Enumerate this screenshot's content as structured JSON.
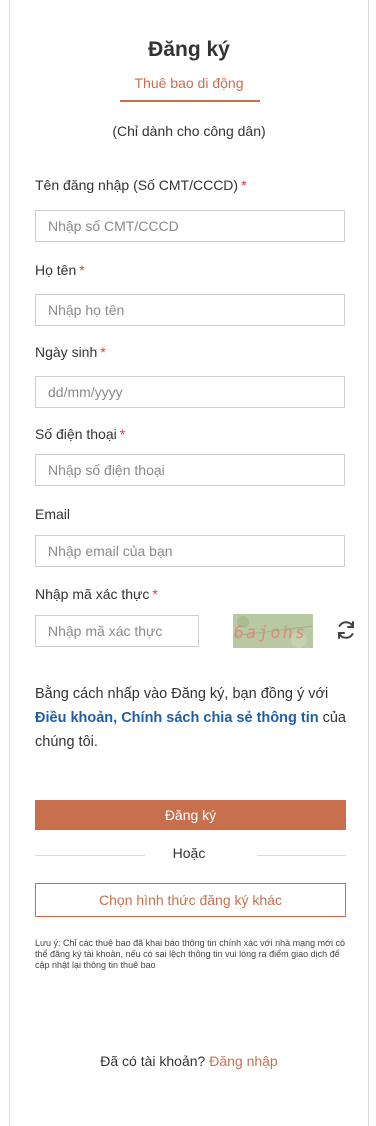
{
  "header": {
    "title": "Đăng ký",
    "subtitle": "Thuê bao di động",
    "citizen_note": "(Chỉ dành cho công dân)"
  },
  "form": {
    "username": {
      "label": "Tên đăng nhập (Số CMT/CCCD)",
      "required_mark": "*",
      "placeholder": "Nhập số CMT/CCCD"
    },
    "fullname": {
      "label": "Họ tên",
      "required_mark": "*",
      "placeholder": "Nhập họ tên"
    },
    "birthday": {
      "label": "Ngày sinh",
      "required_mark": "*",
      "placeholder": "dd/mm/yyyy"
    },
    "phone": {
      "label": "Số điện thoại",
      "required_mark": "*",
      "placeholder": "Nhập số điện thoại"
    },
    "email": {
      "label": "Email",
      "placeholder": "Nhập email của bạn"
    },
    "captcha": {
      "label": "Nhập mã xác thực",
      "required_mark": "*",
      "placeholder": "Nhập mã xác thực",
      "image_text": "6ajohs"
    }
  },
  "consent": {
    "prefix": "Bằng cách nhấp vào Đăng ký, bạn đồng ý với ",
    "link": "Điều khoản, Chính sách chia sẻ thông tin",
    "suffix": " của chúng tôi."
  },
  "actions": {
    "register_label": "Đăng ký",
    "or_label": "Hoặc",
    "other_method_label": "Chọn hình thức đăng ký khác"
  },
  "disclaimer": "Lưu ý: Chỉ các thuê bao đã khai báo thông tin chính xác với nhà mạng mới có thể đăng ký tài khoản, nếu có sai lệch thông tin vui lòng ra điểm giao dịch để cập nhật lại thông tin thuê bao",
  "footer": {
    "question": "Đã có tài khoản?",
    "login_link": "Đăng nhập"
  },
  "icons": {
    "refresh": "refresh-icon"
  },
  "colors": {
    "accent": "#c8704e",
    "link": "#1f5fa8",
    "required": "#e53935"
  }
}
